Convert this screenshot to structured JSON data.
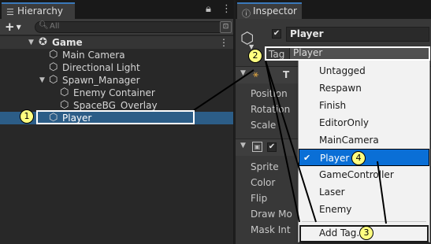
{
  "hierarchy": {
    "tab_title": "Hierarchy",
    "tab_icon": "list-icon",
    "lock_icon": "lock-icon",
    "menu_icon": "kebab-icon",
    "add_button": "+",
    "search_placeholder": "All",
    "scene_name": "Game",
    "items": [
      {
        "label": "Main Camera"
      },
      {
        "label": "Directional Light"
      },
      {
        "label": "Spawn_Manager"
      },
      {
        "label": "Enemy Container"
      },
      {
        "label": "SpaceBG_Overlay"
      },
      {
        "label": "Player"
      }
    ]
  },
  "inspector": {
    "tab_title": "Inspector",
    "object_name": "Player",
    "tag_label": "Tag",
    "tag_value": "Player",
    "transform_header": "T",
    "transform_fields": [
      "Position",
      "Rotation",
      "Scale"
    ],
    "renderer_fields": [
      "Sprite",
      "Color",
      "Flip",
      "Draw Mo",
      "Mask Int"
    ]
  },
  "tag_menu": {
    "items": [
      "Untagged",
      "Respawn",
      "Finish",
      "EditorOnly",
      "MainCamera",
      "Player",
      "GameController",
      "Laser",
      "Enemy"
    ],
    "selected": "Player",
    "add_tag": "Add Tag..."
  },
  "annotations": {
    "step1": "1",
    "step2": "2",
    "step3": "3",
    "step4": "4"
  },
  "colors": {
    "selection": "#2c5d87",
    "menu_highlight": "#0a6fd6",
    "badge": "#ffff80"
  }
}
